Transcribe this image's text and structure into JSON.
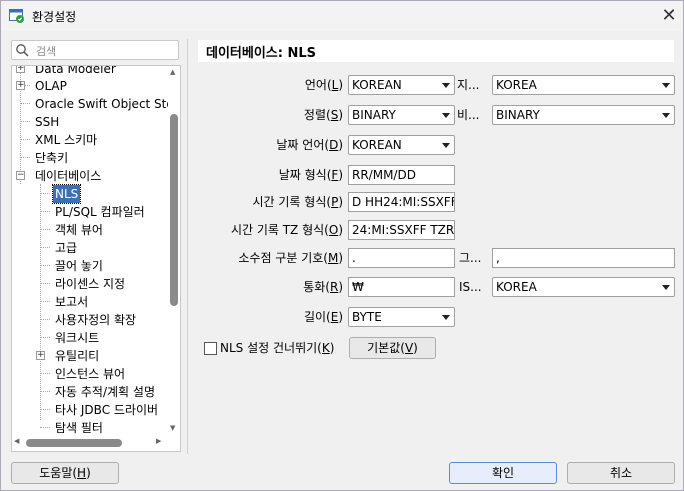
{
  "window": {
    "title": "환경설정",
    "close_icon": "close-icon"
  },
  "search": {
    "placeholder": "검색"
  },
  "tree": {
    "items": [
      {
        "label": "Data Modeler"
      },
      {
        "label": "OLAP"
      },
      {
        "label": "Oracle Swift Object Sto"
      },
      {
        "label": "SSH"
      },
      {
        "label": "XML 스키마"
      },
      {
        "label": "단축키"
      },
      {
        "label": "데이터베이스"
      },
      {
        "label": "NLS"
      },
      {
        "label": "PL/SQL 컴파일러"
      },
      {
        "label": "객체 뷰어"
      },
      {
        "label": "고급"
      },
      {
        "label": "끌어 놓기"
      },
      {
        "label": "라이센스 지정"
      },
      {
        "label": "보고서"
      },
      {
        "label": "사용자정의 확장"
      },
      {
        "label": "워크시트"
      },
      {
        "label": "유틸리티"
      },
      {
        "label": "인스턴스 뷰어"
      },
      {
        "label": "자동 추적/계획 설명"
      },
      {
        "label": "타사 JDBC 드라이버"
      },
      {
        "label": "탐색 필터"
      }
    ]
  },
  "panel": {
    "title": "데이터베이스: NLS",
    "language_label_pre": "언어(",
    "language_key": "L",
    "language_label_post": ")",
    "language_value": "KOREAN",
    "territory_label": "지...",
    "territory_value": "KOREA",
    "sort_label_pre": "정렬(",
    "sort_key": "S",
    "sort_label_post": ")",
    "sort_value": "BINARY",
    "comp_label": "비...",
    "comp_value": "BINARY",
    "date_lang_label_pre": "날짜 언어(",
    "date_lang_key": "D",
    "date_lang_label_post": ")",
    "date_lang_value": "KOREAN",
    "date_fmt_label_pre": "날짜 형식(",
    "date_fmt_key": "F",
    "date_fmt_label_post": ")",
    "date_fmt_value": "RR/MM/DD",
    "ts_label_pre": "시간 기록 형식(",
    "ts_key": "P",
    "ts_label_post": ")",
    "ts_value": "D HH24:MI:SSXFF",
    "tstz_label_pre": "시간 기록 TZ 형식(",
    "tstz_key": "O",
    "tstz_label_post": ")",
    "tstz_value": "24:MI:SSXFF TZR",
    "decimal_label_pre": "소수점 구분 기호(",
    "decimal_key": "M",
    "decimal_label_post": ")",
    "decimal_value": ".",
    "group_label": "그...",
    "group_value": ",",
    "currency_label_pre": "통화(",
    "currency_key": "R",
    "currency_label_post": ")",
    "currency_value": "₩",
    "iso_label": "IS...",
    "iso_value": "KOREA",
    "length_label_pre": "길이(",
    "length_key": "E",
    "length_label_post": ")",
    "length_value": "BYTE",
    "skip_label_pre": "NLS 설정 건너뛰기(",
    "skip_key": "K",
    "skip_label_post": ")",
    "skip_checked": false,
    "default_btn_pre": "기본값(",
    "default_btn_key": "V",
    "default_btn_post": ")"
  },
  "footer": {
    "help_pre": "도움말(",
    "help_key": "H",
    "help_post": ")",
    "ok_label": "확인",
    "cancel_label": "취소"
  }
}
